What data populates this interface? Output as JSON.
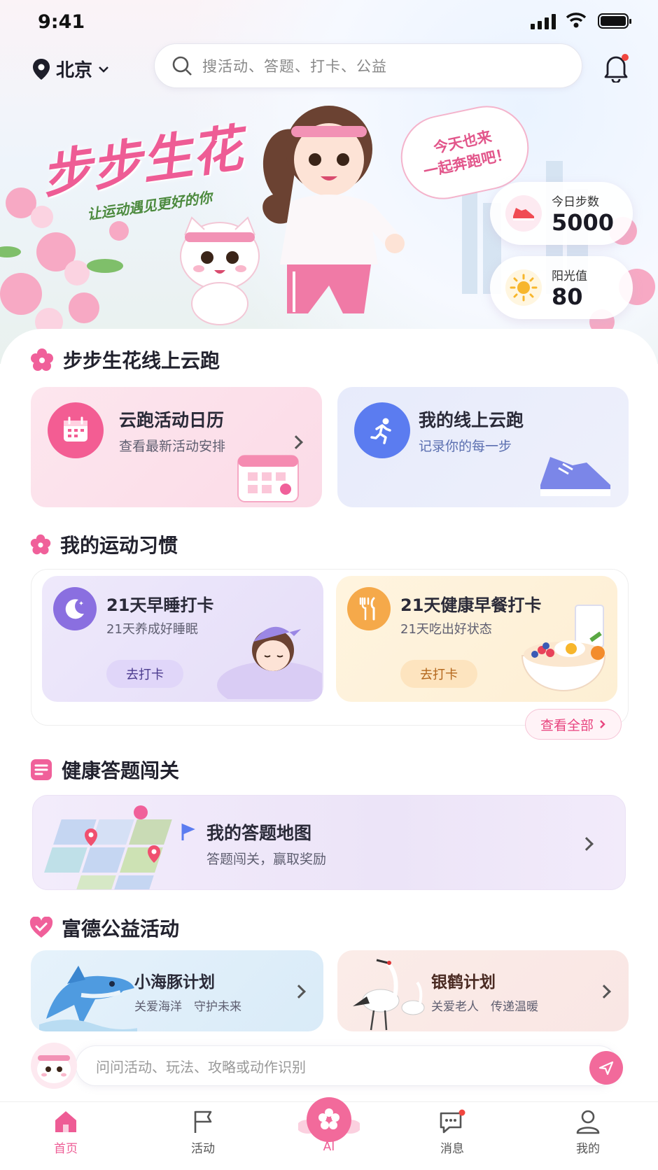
{
  "status": {
    "time": "9:41"
  },
  "header": {
    "city": "北京",
    "search_placeholder": "搜活动、答题、打卡、公益"
  },
  "hero": {
    "title": "步步生花",
    "subtitle": "让运动遇见更好的你",
    "bubble_line1": "今天也来",
    "bubble_line2": "一起奔跑吧！",
    "steps_label": "今日步数",
    "steps_value": "5000",
    "sun_label": "阳光值",
    "sun_value": "80"
  },
  "cloud_run": {
    "section_title": "步步生花线上云跑",
    "calendar": {
      "title": "云跑活动日历",
      "desc": "查看最新活动安排"
    },
    "my_run": {
      "title": "我的线上云跑",
      "desc": "记录你的每一步"
    }
  },
  "habits": {
    "section_title": "我的运动习惯",
    "sleep": {
      "title": "21天早睡打卡",
      "desc": "21天养成好睡眠",
      "button": "去打卡"
    },
    "breakfast": {
      "title": "21天健康早餐打卡",
      "desc": "21天吃出好状态",
      "button": "去打卡"
    },
    "more": "查看全部"
  },
  "quiz": {
    "section_title": "健康答题闯关",
    "map": {
      "title": "我的答题地图",
      "desc": "答题闯关，赢取奖励"
    }
  },
  "charity": {
    "section_title": "富德公益活动",
    "dolphin": {
      "title": "小海豚计划",
      "desc": "关爱海洋　守护未来"
    },
    "crane": {
      "title": "银鹤计划",
      "desc": "关爱老人　传递温暖"
    }
  },
  "ask": {
    "placeholder": "问问活动、玩法、攻略或动作识别"
  },
  "tabs": [
    {
      "label": "首页"
    },
    {
      "label": "活动"
    },
    {
      "label": "AI"
    },
    {
      "label": "消息"
    },
    {
      "label": "我的"
    }
  ],
  "colors": {
    "accent": "#ee5c95",
    "purple": "#8a6fe0",
    "blue": "#5b7cf0",
    "orange": "#f5a94a"
  }
}
